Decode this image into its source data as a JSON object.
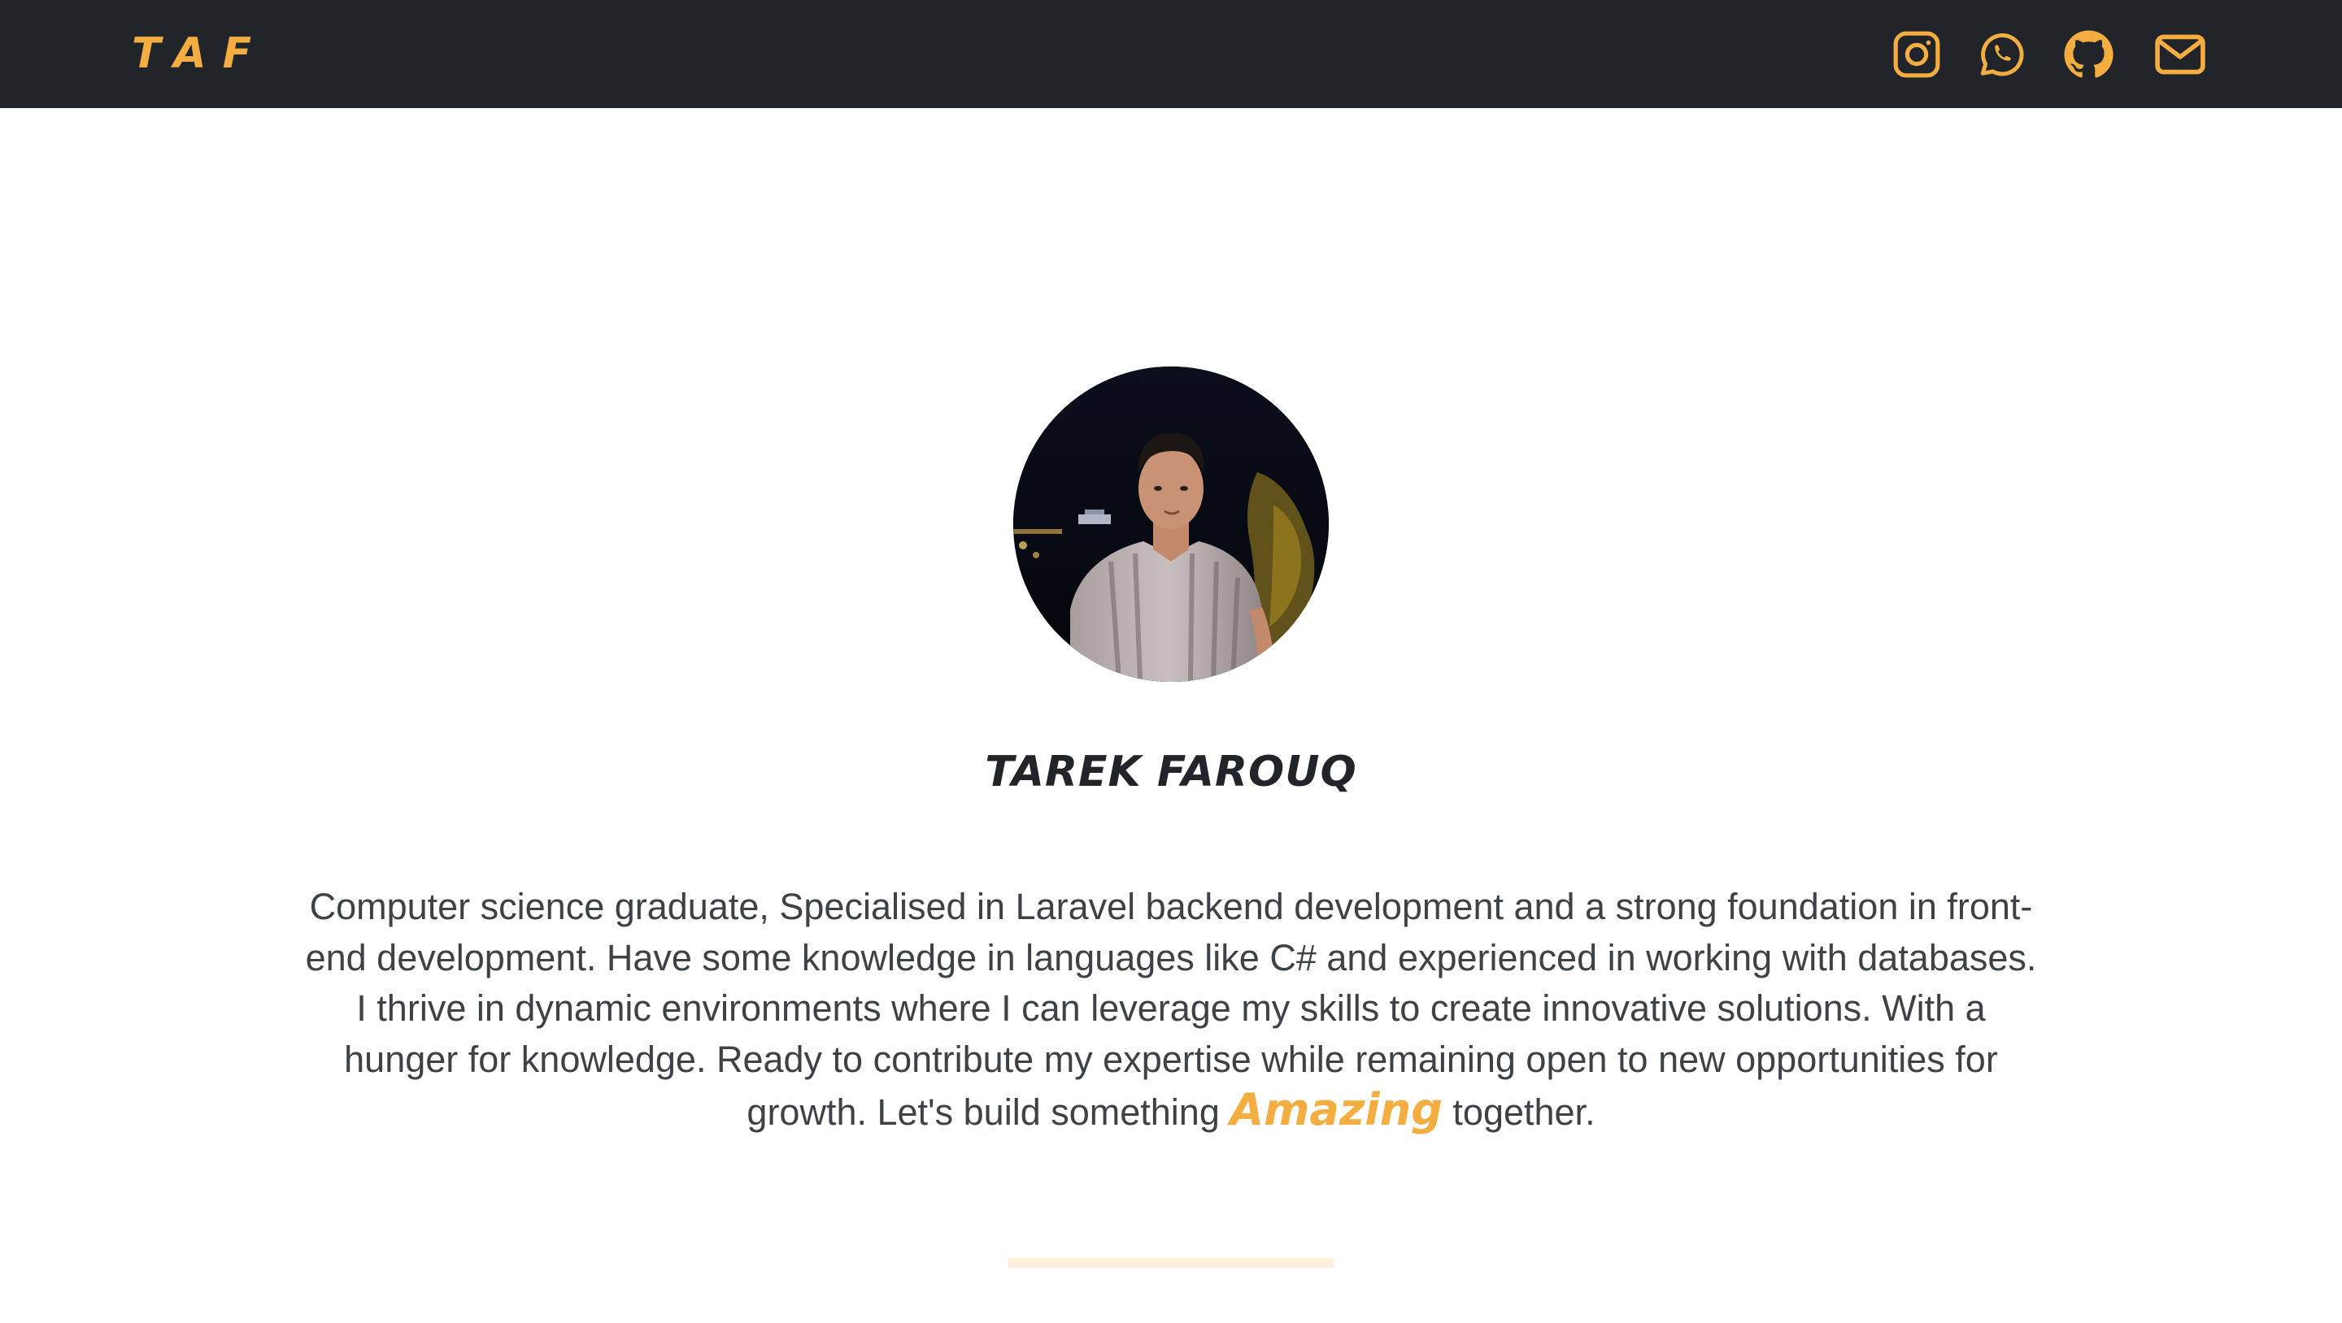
{
  "navbar": {
    "brand": "TAF",
    "social_icons": [
      "instagram-icon",
      "whatsapp-icon",
      "github-icon",
      "mail-icon"
    ],
    "background_color": "#212529",
    "accent_color": "#f4ad41"
  },
  "profile": {
    "name": "TAREK FAROUQ",
    "bio_before": "Computer science graduate, Specialised in Laravel backend development and a strong foundation in front-end development. Have some knowledge in languages like C# and experienced in working with databases. I thrive in dynamic environments where I can leverage my skills to create innovative solutions. With a hunger for knowledge. Ready to contribute my expertise while remaining open to new opportunities for growth. Let's build something",
    "highlight": "Amazing",
    "bio_after": "together."
  }
}
